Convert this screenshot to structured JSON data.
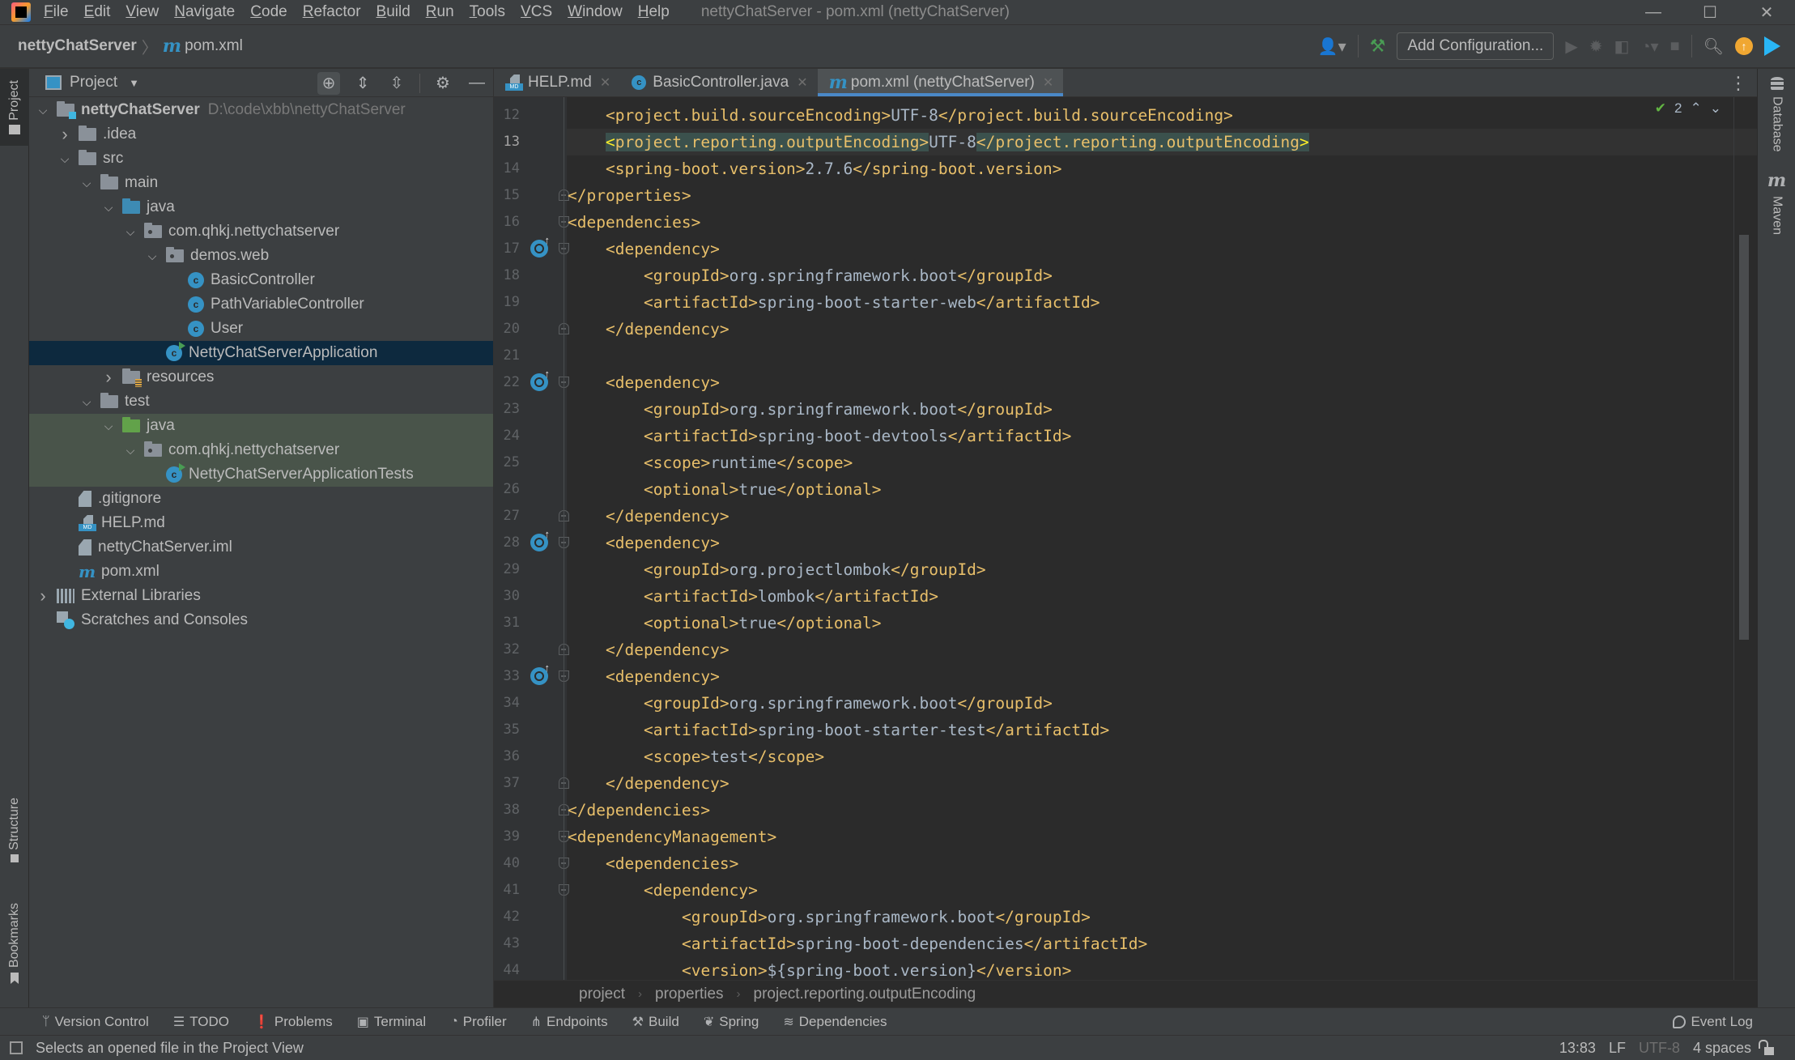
{
  "menubar": {
    "items": [
      "File",
      "Edit",
      "View",
      "Navigate",
      "Code",
      "Refactor",
      "Build",
      "Run",
      "Tools",
      "VCS",
      "Window",
      "Help"
    ],
    "window_title": "nettyChatServer - pom.xml (nettyChatServer)",
    "controls": {
      "minimize": "—",
      "maximize": "☐",
      "close": "✕"
    }
  },
  "navbar": {
    "project": "nettyChatServer",
    "file_icon": "m",
    "file": "pom.xml",
    "add_configuration": "Add Configuration...",
    "icons": [
      "user-icon",
      "build-hammer-icon",
      "run-icon",
      "debug-icon",
      "coverage-icon",
      "profile-icon",
      "stop-icon",
      "search-icon",
      "update-icon",
      "toolbox-icon"
    ]
  },
  "left_strip": {
    "top_tab": "Project",
    "bottom_tabs": [
      "Structure",
      "Bookmarks"
    ]
  },
  "right_strip": {
    "tabs": [
      "Database",
      "Maven"
    ]
  },
  "project_panel": {
    "title": "Project",
    "tools": [
      "locate-icon",
      "expand-all-icon",
      "collapse-all-icon",
      "gear-icon",
      "hide-icon"
    ],
    "tree": [
      {
        "label": "nettyChatServer",
        "hint": "D:\\code\\xbb\\nettyChatServer",
        "depth": 0,
        "expanded": true,
        "icon": "module-folder",
        "bold": true
      },
      {
        "label": ".idea",
        "depth": 1,
        "expanded": false,
        "icon": "folder"
      },
      {
        "label": "src",
        "depth": 1,
        "expanded": true,
        "icon": "folder"
      },
      {
        "label": "main",
        "depth": 2,
        "expanded": true,
        "icon": "folder"
      },
      {
        "label": "java",
        "depth": 3,
        "expanded": true,
        "icon": "source-folder"
      },
      {
        "label": "com.qhkj.nettychatserver",
        "depth": 4,
        "expanded": true,
        "icon": "package"
      },
      {
        "label": "demos.web",
        "depth": 5,
        "expanded": true,
        "icon": "package"
      },
      {
        "label": "BasicController",
        "depth": 6,
        "icon": "class"
      },
      {
        "label": "PathVariableController",
        "depth": 6,
        "icon": "class"
      },
      {
        "label": "User",
        "depth": 6,
        "icon": "class"
      },
      {
        "label": "NettyChatServerApplication",
        "depth": 5,
        "icon": "spring-boot-class",
        "selected": true
      },
      {
        "label": "resources",
        "depth": 3,
        "expanded": false,
        "icon": "resources-folder"
      },
      {
        "label": "test",
        "depth": 2,
        "expanded": true,
        "icon": "folder"
      },
      {
        "label": "java",
        "depth": 3,
        "expanded": true,
        "icon": "test-folder",
        "test": true
      },
      {
        "label": "com.qhkj.nettychatserver",
        "depth": 4,
        "expanded": true,
        "icon": "package",
        "test": true
      },
      {
        "label": "NettyChatServerApplicationTests",
        "depth": 5,
        "icon": "test-class",
        "test": true
      },
      {
        "label": ".gitignore",
        "depth": 1,
        "icon": "ignore-file"
      },
      {
        "label": "HELP.md",
        "depth": 1,
        "icon": "markdown-file"
      },
      {
        "label": "nettyChatServer.iml",
        "depth": 1,
        "icon": "iml-file"
      },
      {
        "label": "pom.xml",
        "depth": 1,
        "icon": "maven-file"
      },
      {
        "label": "External Libraries",
        "depth": 0,
        "expanded": false,
        "icon": "libraries"
      },
      {
        "label": "Scratches and Consoles",
        "depth": 0,
        "icon": "scratches"
      }
    ]
  },
  "editor_tabs": [
    {
      "label": "HELP.md",
      "icon": "markdown-file",
      "active": false
    },
    {
      "label": "BasicController.java",
      "icon": "class",
      "active": false
    },
    {
      "label": "pom.xml (nettyChatServer)",
      "icon": "maven-file",
      "active": true
    }
  ],
  "editor": {
    "inspection_count": "2",
    "current_line": 13,
    "lines": [
      {
        "n": 12,
        "indent": 2,
        "parts": [
          [
            "tag",
            "<project.build.sourceEncoding>"
          ],
          [
            "val",
            "UTF-8"
          ],
          [
            "tag",
            "</project.build.sourceEncoding>"
          ]
        ]
      },
      {
        "n": 13,
        "indent": 2,
        "highlight": true,
        "parts": [
          [
            "tag",
            "<project.reporting.outputEncoding>"
          ],
          [
            "val",
            "UTF-8"
          ],
          [
            "tag",
            "</project.reporting.outputEncoding>"
          ]
        ]
      },
      {
        "n": 14,
        "indent": 2,
        "parts": [
          [
            "tag",
            "<spring-boot.version>"
          ],
          [
            "val",
            "2.7.6"
          ],
          [
            "tag",
            "</spring-boot.version>"
          ]
        ]
      },
      {
        "n": 15,
        "indent": 1,
        "fold": "close",
        "parts": [
          [
            "tag",
            "</properties>"
          ]
        ]
      },
      {
        "n": 16,
        "indent": 1,
        "fold": "open",
        "parts": [
          [
            "tag",
            "<dependencies>"
          ]
        ]
      },
      {
        "n": 17,
        "indent": 2,
        "fold": "open",
        "gutter": true,
        "parts": [
          [
            "tag",
            "<dependency>"
          ]
        ]
      },
      {
        "n": 18,
        "indent": 3,
        "parts": [
          [
            "tag",
            "<groupId>"
          ],
          [
            "val",
            "org.springframework.boot"
          ],
          [
            "tag",
            "</groupId>"
          ]
        ]
      },
      {
        "n": 19,
        "indent": 3,
        "parts": [
          [
            "tag",
            "<artifactId>"
          ],
          [
            "val",
            "spring-boot-starter-web"
          ],
          [
            "tag",
            "</artifactId>"
          ]
        ]
      },
      {
        "n": 20,
        "indent": 2,
        "fold": "close",
        "parts": [
          [
            "tag",
            "</dependency>"
          ]
        ]
      },
      {
        "n": 21,
        "indent": 0,
        "parts": []
      },
      {
        "n": 22,
        "indent": 2,
        "fold": "open",
        "gutter": true,
        "parts": [
          [
            "tag",
            "<dependency>"
          ]
        ]
      },
      {
        "n": 23,
        "indent": 3,
        "parts": [
          [
            "tag",
            "<groupId>"
          ],
          [
            "val",
            "org.springframework.boot"
          ],
          [
            "tag",
            "</groupId>"
          ]
        ]
      },
      {
        "n": 24,
        "indent": 3,
        "parts": [
          [
            "tag",
            "<artifactId>"
          ],
          [
            "val",
            "spring-boot-devtools"
          ],
          [
            "tag",
            "</artifactId>"
          ]
        ]
      },
      {
        "n": 25,
        "indent": 3,
        "parts": [
          [
            "tag",
            "<scope>"
          ],
          [
            "val",
            "runtime"
          ],
          [
            "tag",
            "</scope>"
          ]
        ]
      },
      {
        "n": 26,
        "indent": 3,
        "parts": [
          [
            "tag",
            "<optional>"
          ],
          [
            "val",
            "true"
          ],
          [
            "tag",
            "</optional>"
          ]
        ]
      },
      {
        "n": 27,
        "indent": 2,
        "fold": "close",
        "parts": [
          [
            "tag",
            "</dependency>"
          ]
        ]
      },
      {
        "n": 28,
        "indent": 2,
        "fold": "open",
        "gutter": true,
        "parts": [
          [
            "tag",
            "<dependency>"
          ]
        ]
      },
      {
        "n": 29,
        "indent": 3,
        "parts": [
          [
            "tag",
            "<groupId>"
          ],
          [
            "val",
            "org.projectlombok"
          ],
          [
            "tag",
            "</groupId>"
          ]
        ]
      },
      {
        "n": 30,
        "indent": 3,
        "parts": [
          [
            "tag",
            "<artifactId>"
          ],
          [
            "val",
            "lombok"
          ],
          [
            "tag",
            "</artifactId>"
          ]
        ]
      },
      {
        "n": 31,
        "indent": 3,
        "parts": [
          [
            "tag",
            "<optional>"
          ],
          [
            "val",
            "true"
          ],
          [
            "tag",
            "</optional>"
          ]
        ]
      },
      {
        "n": 32,
        "indent": 2,
        "fold": "close",
        "parts": [
          [
            "tag",
            "</dependency>"
          ]
        ]
      },
      {
        "n": 33,
        "indent": 2,
        "fold": "open",
        "gutter": true,
        "parts": [
          [
            "tag",
            "<dependency>"
          ]
        ]
      },
      {
        "n": 34,
        "indent": 3,
        "parts": [
          [
            "tag",
            "<groupId>"
          ],
          [
            "val",
            "org.springframework.boot"
          ],
          [
            "tag",
            "</groupId>"
          ]
        ]
      },
      {
        "n": 35,
        "indent": 3,
        "parts": [
          [
            "tag",
            "<artifactId>"
          ],
          [
            "val",
            "spring-boot-starter-test"
          ],
          [
            "tag",
            "</artifactId>"
          ]
        ]
      },
      {
        "n": 36,
        "indent": 3,
        "parts": [
          [
            "tag",
            "<scope>"
          ],
          [
            "val",
            "test"
          ],
          [
            "tag",
            "</scope>"
          ]
        ]
      },
      {
        "n": 37,
        "indent": 2,
        "fold": "close",
        "parts": [
          [
            "tag",
            "</dependency>"
          ]
        ]
      },
      {
        "n": 38,
        "indent": 1,
        "fold": "close",
        "parts": [
          [
            "tag",
            "</dependencies>"
          ]
        ]
      },
      {
        "n": 39,
        "indent": 1,
        "fold": "open",
        "parts": [
          [
            "tag",
            "<dependencyManagement>"
          ]
        ]
      },
      {
        "n": 40,
        "indent": 2,
        "fold": "open",
        "parts": [
          [
            "tag",
            "<dependencies>"
          ]
        ]
      },
      {
        "n": 41,
        "indent": 3,
        "fold": "open",
        "parts": [
          [
            "tag",
            "<dependency>"
          ]
        ]
      },
      {
        "n": 42,
        "indent": 4,
        "parts": [
          [
            "tag",
            "<groupId>"
          ],
          [
            "val",
            "org.springframework.boot"
          ],
          [
            "tag",
            "</groupId>"
          ]
        ]
      },
      {
        "n": 43,
        "indent": 4,
        "parts": [
          [
            "tag",
            "<artifactId>"
          ],
          [
            "val",
            "spring-boot-dependencies"
          ],
          [
            "tag",
            "</artifactId>"
          ]
        ]
      },
      {
        "n": 44,
        "indent": 4,
        "parts": [
          [
            "tag",
            "<version>"
          ],
          [
            "val",
            "${spring-boot.version}"
          ],
          [
            "tag",
            "</version>"
          ]
        ]
      }
    ]
  },
  "breadcrumbs": [
    "project",
    "properties",
    "project.reporting.outputEncoding"
  ],
  "tool_windows": [
    {
      "label": "Version Control",
      "icon": "version-control-icon",
      "glyph": "ᛘ"
    },
    {
      "label": "TODO",
      "icon": "todo-icon",
      "glyph": "☰"
    },
    {
      "label": "Problems",
      "icon": "problems-icon",
      "glyph": "❗"
    },
    {
      "label": "Terminal",
      "icon": "terminal-icon",
      "glyph": "▣"
    },
    {
      "label": "Profiler",
      "icon": "profiler-icon",
      "glyph": "◔"
    },
    {
      "label": "Endpoints",
      "icon": "endpoints-icon",
      "glyph": "⋔"
    },
    {
      "label": "Build",
      "icon": "build-icon",
      "glyph": "⚒"
    },
    {
      "label": "Spring",
      "icon": "spring-icon",
      "glyph": "❦"
    },
    {
      "label": "Dependencies",
      "icon": "dependencies-icon",
      "glyph": "≋"
    }
  ],
  "event_log": "Event Log",
  "statusbar": {
    "message": "Selects an opened file in the Project View",
    "position": "13:83",
    "line_separator": "LF",
    "encoding": "UTF-8",
    "indent": "4 spaces"
  },
  "colors": {
    "tag": "#e8bf6a",
    "value": "#a9b7c6",
    "accent": "#4a88c7",
    "selection": "#0d293e",
    "test_bg": "#49544a"
  }
}
